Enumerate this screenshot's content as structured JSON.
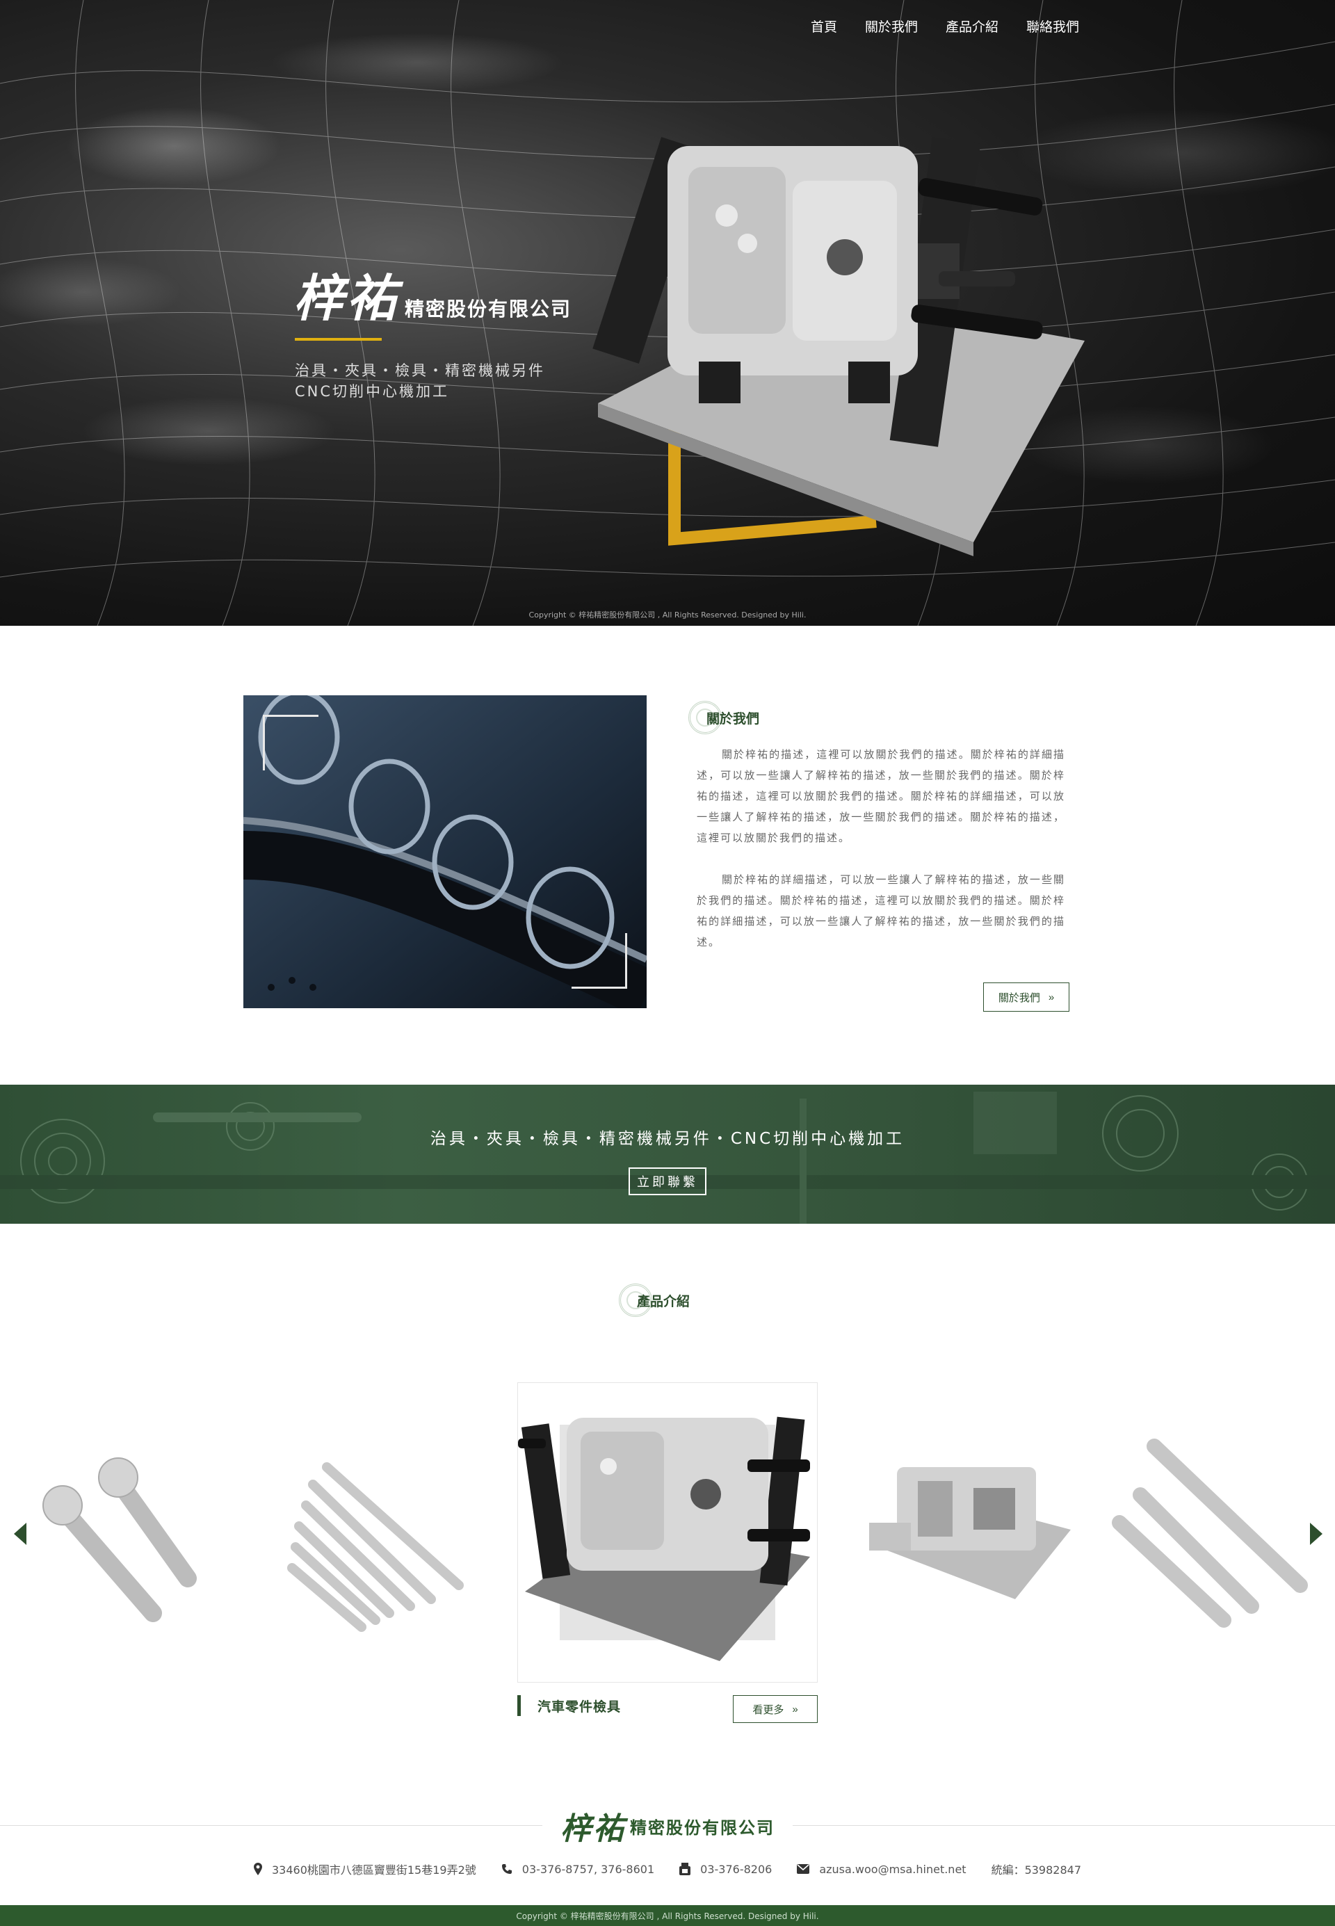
{
  "nav": {
    "items": [
      {
        "label": "首頁"
      },
      {
        "label": "關於我們"
      },
      {
        "label": "產品介紹"
      },
      {
        "label": "聯絡我們"
      }
    ]
  },
  "hero": {
    "brand_big": "梓祐",
    "brand_small": "精密股份有限公司",
    "subtitle_line1": "治具・夾具・檢具・精密機械另件",
    "subtitle_line2": "CNC切削中心機加工",
    "copyright": "Copyright © 梓祐精密股份有限公司 , All Rights Reserved. Designed by Hili."
  },
  "about": {
    "title": "關於我們",
    "paragraph1": "關於梓祐的描述，這裡可以放關於我們的描述。關於梓祐的詳細描述，可以放一些讓人了解梓祐的描述，放一些關於我們的描述。關於梓祐的描述，這裡可以放關於我們的描述。關於梓祐的詳細描述，可以放一些讓人了解梓祐的描述，放一些關於我們的描述。關於梓祐的描述，這裡可以放關於我們的描述。",
    "paragraph2": "關於梓祐的詳細描述，可以放一些讓人了解梓祐的描述，放一些關於我們的描述。關於梓祐的描述，這裡可以放關於我們的描述。關於梓祐的詳細描述，可以放一些讓人了解梓祐的描述，放一些關於我們的描述。",
    "button_label": "關於我們"
  },
  "banner": {
    "text": "治具・夾具・檢具・精密機械另件・CNC切削中心機加工",
    "button_label": "立即聯繫"
  },
  "products": {
    "title": "產品介紹",
    "featured_name": "汽車零件檢具",
    "more_label": "看更多"
  },
  "footer": {
    "brand_big": "梓祐",
    "brand_small": "精密股份有限公司",
    "address": "33460桃園市八德區竇豐街15巷19弄2號",
    "phone": "03-376-8757, 376-8601",
    "fax": "03-376-8206",
    "email": "azusa.woo@msa.hinet.net",
    "tax_id": "統編：53982847",
    "copyright": "Copyright © 梓祐精密股份有限公司 , All Rights Reserved. Designed by Hili."
  },
  "colors": {
    "brand_green": "#2d5a2d",
    "accent_gold": "#e0b010",
    "hero_dark": "#141414"
  }
}
